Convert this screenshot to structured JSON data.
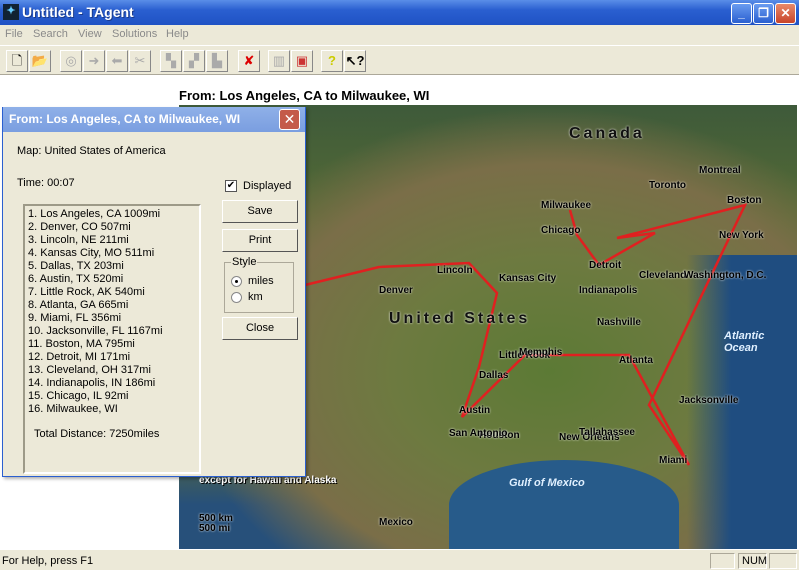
{
  "window": {
    "title": "Untitled - TAgent",
    "icon": "app-icon"
  },
  "menu": [
    "File",
    "Search",
    "View",
    "Solutions",
    "Help"
  ],
  "toolbar": [
    "new-icon",
    "open-icon",
    "tool3-icon",
    "tool4-icon",
    "tool5-icon",
    "tool6-icon",
    "tool7-icon",
    "tool8-icon",
    "tool9-icon",
    "delete-icon",
    "tool11-icon",
    "tool12-icon",
    "help-icon",
    "context-help-icon"
  ],
  "heading": "From: Los Angeles, CA  to  Milwaukee, WI",
  "dialog": {
    "title": "From: Los Angeles, CA  to  Milwaukee, WI",
    "map_label": "Map: United States of America",
    "time": "Time: 00:07",
    "displayed_label": "Displayed",
    "displayed": true,
    "save": "Save",
    "print": "Print",
    "close": "Close",
    "style_label": "Style",
    "miles": "miles",
    "km": "km",
    "style_selected": "miles",
    "route": [
      "1. Los Angeles, CA 1009mi",
      "2. Denver, CO 507mi",
      "3. Lincoln, NE 211mi",
      "4. Kansas City, MO 511mi",
      "5. Dallas, TX 203mi",
      "6. Austin, TX 520mi",
      "7. Little Rock, AK 540mi",
      "8. Atlanta, GA 665mi",
      "9. Miami, FL 356mi",
      "10. Jacksonville, FL 1167mi",
      "11. Boston, MA 795mi",
      "12. Detroit, MI 171mi",
      "13. Cleveland, OH 317mi",
      "14. Indianapolis, IN 186mi",
      "15. Chicago, IL 92mi",
      "16. Milwaukee, WI"
    ],
    "total": "Total Distance: 7250miles"
  },
  "map": {
    "labels": [
      "Canada",
      "United States",
      "Atlantic Ocean",
      "Gulf of Mexico",
      "Mexico",
      "Denver",
      "Lincoln",
      "Kansas City",
      "Dallas",
      "Austin",
      "Little Rock",
      "Atlanta",
      "Miami",
      "Jacksonville",
      "Boston",
      "Detroit",
      "Cleveland",
      "Indianapolis",
      "Chicago",
      "Milwaukee",
      "Houston",
      "San Antonio",
      "New Orleans",
      "Memphis",
      "Nashville",
      "Washington, D.C.",
      "New York",
      "Montreal",
      "Toronto",
      "Tallahassee",
      "except for Hawaii and Alaska",
      "500 km",
      "500 mi"
    ],
    "route_color": "#e02020"
  },
  "status": {
    "help": "For Help, press F1",
    "num": "NUM"
  }
}
